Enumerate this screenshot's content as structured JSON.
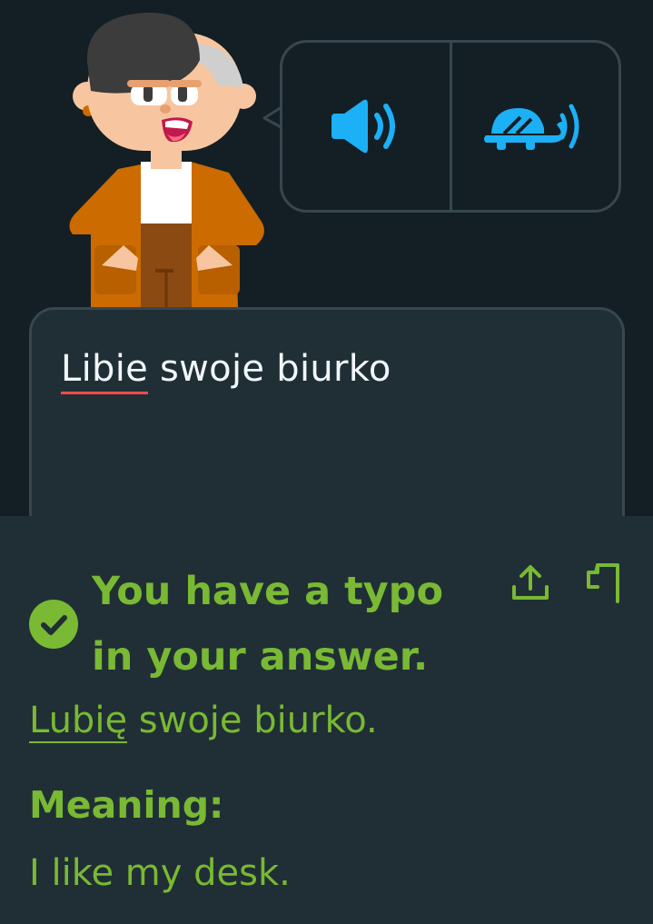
{
  "character": {
    "icon": "character-lily-avatar"
  },
  "audio": {
    "normal_icon": "speaker-icon",
    "slow_icon": "turtle-speaker-icon",
    "accent_color": "#1cb0f6"
  },
  "answer": {
    "typo_word": "Libie",
    "rest": " swoje biurko"
  },
  "feedback": {
    "status_icon": "check-icon",
    "title": "You have a typo in your answer.",
    "correct_word": "Lubię",
    "correct_rest": " swoje biurko.",
    "meaning_label": "Meaning:",
    "meaning_text": "I like my desk.",
    "accent_color": "#79b933",
    "share_icon": "share-icon",
    "report_icon": "flag-icon"
  }
}
